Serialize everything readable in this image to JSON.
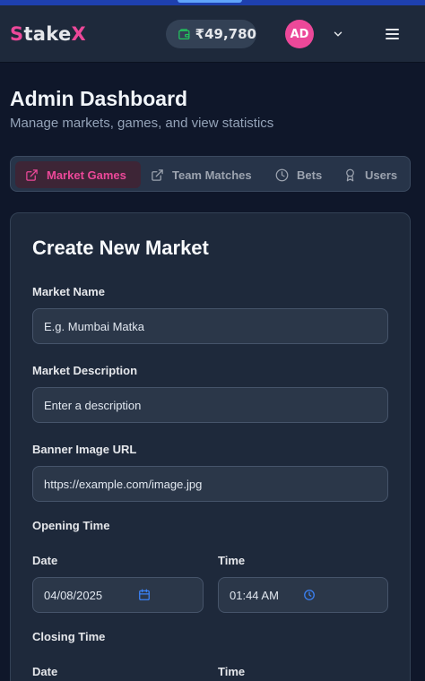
{
  "header": {
    "logo_first": "S",
    "logo_rest": "take",
    "logo_last": "X",
    "balance": "₹49,780",
    "avatar_initials": "AD",
    "colors": {
      "accent": "#ec4899",
      "wallet": "#22c55e"
    }
  },
  "page": {
    "title": "Admin Dashboard",
    "subtitle": "Manage markets, games, and view statistics"
  },
  "tabs": [
    {
      "label": "Market Games",
      "icon": "external-link-icon",
      "active": true
    },
    {
      "label": "Team Matches",
      "icon": "external-link-icon",
      "active": false
    },
    {
      "label": "Bets",
      "icon": "clock-icon",
      "active": false
    },
    {
      "label": "Users",
      "icon": "award-icon",
      "active": false
    }
  ],
  "form": {
    "title": "Create New Market",
    "market_name": {
      "label": "Market Name",
      "placeholder": "E.g. Mumbai Matka"
    },
    "market_description": {
      "label": "Market Description",
      "placeholder": "Enter a description"
    },
    "banner_url": {
      "label": "Banner Image URL",
      "placeholder": "https://example.com/image.jpg"
    },
    "opening": {
      "heading": "Opening Time",
      "date_label": "Date",
      "date_value": "04/08/2025",
      "time_label": "Time",
      "time_value": "01:44 AM"
    },
    "closing": {
      "heading": "Closing Time",
      "date_label": "Date",
      "time_label": "Time"
    }
  }
}
